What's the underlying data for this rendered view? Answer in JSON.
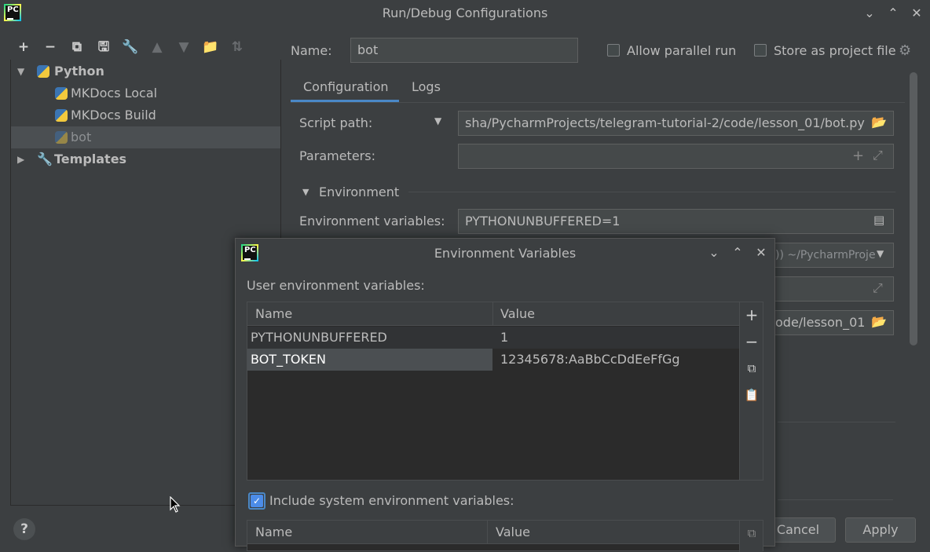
{
  "window": {
    "title": "Run/Debug Configurations"
  },
  "tree": {
    "python_label": "Python",
    "items": [
      {
        "label": "MKDocs Local"
      },
      {
        "label": "MKDocs Build"
      },
      {
        "label": "bot"
      }
    ],
    "templates_label": "Templates"
  },
  "config": {
    "name_label": "Name:",
    "name_value": "bot",
    "allow_parallel_label": "Allow parallel run",
    "store_project_label": "Store as project file",
    "tabs": [
      {
        "label": "Configuration"
      },
      {
        "label": "Logs"
      }
    ],
    "script_path_label": "Script path:",
    "script_path_value": "sha/PycharmProjects/telegram-tutorial-2/code/lesson_01/bot.py",
    "parameters_label": "Parameters:",
    "environment_label": "Environment",
    "env_vars_label": "Environment variables:",
    "env_vars_value": "PYTHONUNBUFFERED=1",
    "interpreter_partial": ")) ~/PycharmProje",
    "workdir_partial": "ode/lesson_01",
    "cancel_label": "Cancel",
    "apply_label": "Apply"
  },
  "dialog": {
    "title": "Environment Variables",
    "user_vars_label": "User environment variables:",
    "columns": {
      "name": "Name",
      "value": "Value"
    },
    "rows": [
      {
        "name": "PYTHONUNBUFFERED",
        "value": "1"
      },
      {
        "name": "BOT_TOKEN",
        "value": "12345678:AaBbCcDdEeFfGg"
      }
    ],
    "include_system_label": "Include system environment variables:",
    "include_system_checked": true,
    "system_columns": {
      "name": "Name",
      "value": "Value"
    }
  },
  "help_label": "?",
  "colors": {
    "accent": "#4a88c7",
    "checkbox": "#4c8ce8",
    "selection": "#4b4f52"
  }
}
